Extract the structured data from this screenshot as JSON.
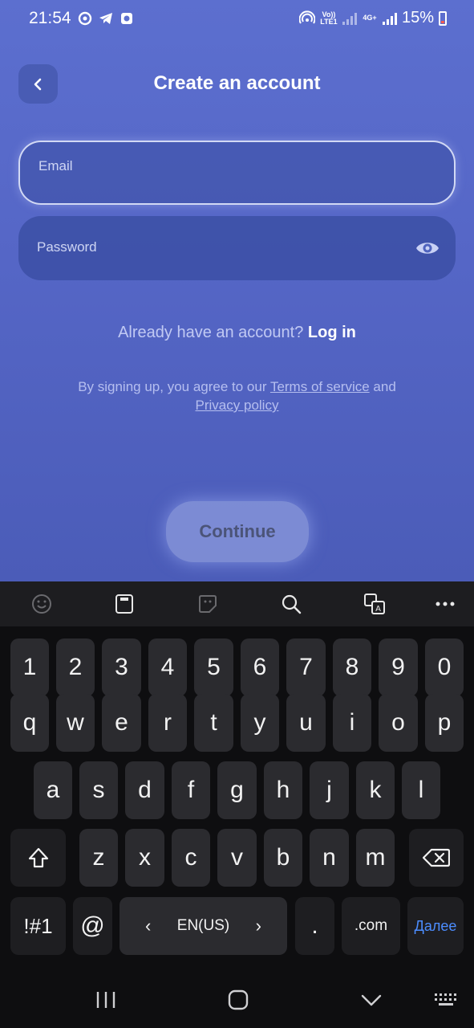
{
  "status_bar": {
    "time": "21:54",
    "battery": "15%",
    "net_volte": "Vo)) LTE1",
    "net_type": "4G+"
  },
  "header": {
    "title": "Create an account",
    "back_icon": "chevron-left-icon"
  },
  "form": {
    "email_label": "Email",
    "password_label": "Password",
    "password_toggle_icon": "eye-icon"
  },
  "login_prompt": {
    "text": "Already have an account?",
    "link": "Log in"
  },
  "terms": {
    "prefix": "By signing up, you agree to our",
    "terms_link": "Terms of service",
    "conjunction": "and",
    "privacy_link": "Privacy policy"
  },
  "continue_button": {
    "label": "Continue"
  },
  "keyboard": {
    "toolbar_icons": [
      "emoji-icon",
      "clipboard-icon",
      "sticker-icon",
      "search-icon",
      "translate-icon",
      "more-icon"
    ],
    "row_numbers": [
      "1",
      "2",
      "3",
      "4",
      "5",
      "6",
      "7",
      "8",
      "9",
      "0"
    ],
    "row_top": [
      "q",
      "w",
      "e",
      "r",
      "t",
      "y",
      "u",
      "i",
      "o",
      "p"
    ],
    "row_middle": [
      "a",
      "s",
      "d",
      "f",
      "g",
      "h",
      "j",
      "k",
      "l"
    ],
    "row_bottom": [
      "z",
      "x",
      "c",
      "v",
      "b",
      "n",
      "m"
    ],
    "symbols_key": "!#1",
    "at_key": "@",
    "language": "EN(US)",
    "period_key": ".",
    "dotcom_key": ".com",
    "done_key": "Далее"
  },
  "colors": {
    "app_background": "#5a6cc9",
    "keyboard_background": "#0e0e10",
    "key_background": "#2b2b2f",
    "done_key_text": "#4c8dff"
  }
}
